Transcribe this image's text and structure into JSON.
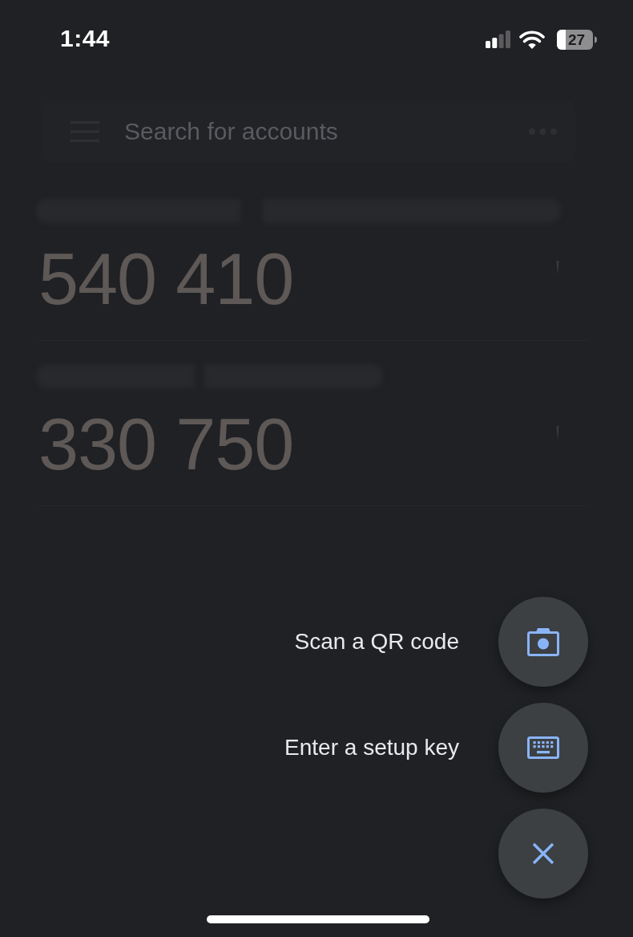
{
  "status_bar": {
    "time": "1:44",
    "battery": "27"
  },
  "app_bar": {
    "search": {
      "placeholder": "Search for accounts"
    }
  },
  "accounts": [
    {
      "code": "540 410"
    },
    {
      "code": "330 750"
    }
  ],
  "speed_dial": {
    "expanded": true,
    "actions": [
      {
        "kind": "camera",
        "label": "Scan a QR code"
      },
      {
        "kind": "keyboard",
        "label": "Enter a setup key"
      }
    ]
  }
}
